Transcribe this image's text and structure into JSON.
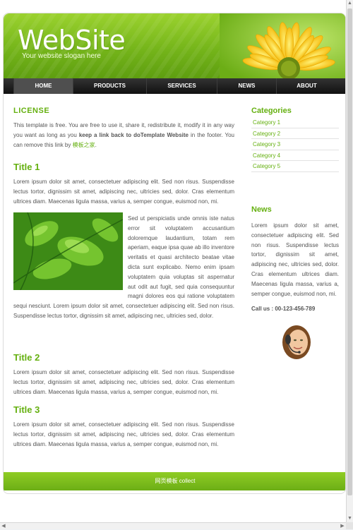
{
  "header": {
    "site_title": "WebSite",
    "slogan": "Your website slogan here"
  },
  "nav": {
    "items": [
      {
        "label": "HOME",
        "active": true
      },
      {
        "label": "PRODUCTS",
        "active": false
      },
      {
        "label": "SERVICES",
        "active": false
      },
      {
        "label": "NEWS",
        "active": false
      },
      {
        "label": "ABOUT",
        "active": false
      }
    ]
  },
  "license": {
    "title": "LICENSE",
    "text_before": "This template is free. You are free to use it, share it, redistribute it, modify it in any way you want as long as you ",
    "text_bold": "keep a link back to doTemplate Website",
    "text_after": " in the footer. You can remove this link by ",
    "link": "模板之家",
    "text_end": "."
  },
  "sections": [
    {
      "title": "Title 1",
      "text": "Lorem ipsum dolor sit amet, consectetuer adipiscing elit. Sed non risus. Suspendisse lectus tortor, dignissim sit amet, adipiscing nec, ultricies sed, dolor. Cras elementum ultrices diam. Maecenas ligula massa, varius a, semper congue, euismod non, mi."
    },
    {
      "title": "Title 2",
      "text": "Lorem ipsum dolor sit amet, consectetuer adipiscing elit. Sed non risus. Suspendisse lectus tortor, dignissim sit amet, adipiscing nec, ultricies sed, dolor. Cras elementum ultrices diam. Maecenas ligula massa, varius a, semper congue, euismod non, mi."
    },
    {
      "title": "Title 3",
      "text": "Lorem ipsum dolor sit amet, consectetuer adipiscing elit. Sed non risus. Suspendisse lectus tortor, dignissim sit amet, adipiscing nec, ultricies sed, dolor. Cras elementum ultrices diam. Maecenas ligula massa, varius a, semper congue, euismod non, mi."
    }
  ],
  "image_paragraph": "Sed ut perspiciatis unde omnis iste natus error sit voluptatem accusantium doloremque laudantium, totam rem aperiam, eaque ipsa quae ab illo inventore veritatis et quasi architecto beatae vitae dicta sunt explicabo. Nemo enim ipsam voluptatem quia voluptas sit aspernatur aut odit aut fugit, sed quia consequuntur magni dolores eos qui ratione voluptatem sequi nesciunt. Lorem ipsum dolor sit amet, consectetuer adipiscing elit. Sed non risus. Suspendisse lectus tortor, dignissim sit amet, adipiscing nec, ultricies sed, dolor.",
  "sidebar": {
    "categories_title": "Categories",
    "categories": [
      "Category 1",
      "Category 2",
      "Category 3",
      "Category 4",
      "Category 5"
    ],
    "news_title": "News",
    "news_text": "Lorem ipsum dolor sit amet, consectetuer adipiscing elit. Sed non risus. Suspendisse lectus tortor, dignissim sit amet, adipiscing nec, ultricies sed, dolor. Cras elementum ultrices diam. Maecenas ligula massa, varius a, semper congue, euismod non, mi.",
    "call": "Call us : 00-123-456-789"
  },
  "footer": {
    "text": "网页模板 collect"
  },
  "colors": {
    "accent_green": "#65b010",
    "nav_dark": "#111111"
  }
}
